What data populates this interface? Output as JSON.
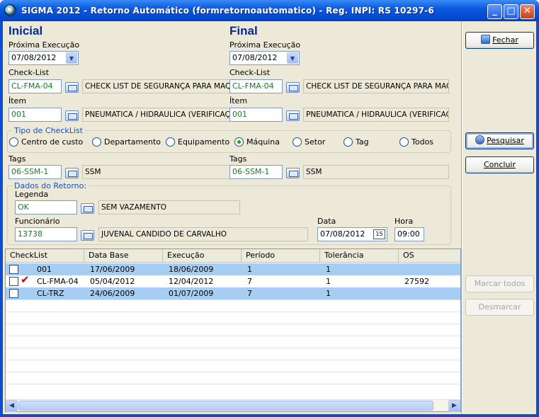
{
  "window": {
    "title": "SIGMA 2012 - Retorno Automático  (formretornoautomatico)  - Reg. INPI: RS 10297-6"
  },
  "inicial": {
    "heading": "Inicial",
    "proxima_label": "Próxima Execução",
    "proxima_value": "07/08/2012",
    "checklist_label": "Check-List",
    "checklist_code": "CL-FMA-04",
    "checklist_desc": "CHECK LIST DE SEGURANÇA PARA MAQU",
    "item_label": "Ítem",
    "item_code": "001",
    "item_desc": "PNEUMATICA / HIDRAULICA (VERIFICAÇ",
    "tags_label": "Tags",
    "tags_code": "06-SSM-1",
    "tags_desc": "SSM"
  },
  "final": {
    "heading": "Final",
    "proxima_label": "Próxima Execução",
    "proxima_value": "07/08/2012",
    "checklist_label": "Check-List",
    "checklist_code": "CL-FMA-04",
    "checklist_desc": "CHECK LIST DE SEGURANÇA PARA MAQU",
    "item_label": "Ítem",
    "item_code": "001",
    "item_desc": "PNEUMATICA / HIDRAULICA (VERIFICAÇ",
    "tags_label": "Tags",
    "tags_code": "06-SSM-1",
    "tags_desc": "SSM"
  },
  "tipo": {
    "title": "Tipo de CheckList",
    "options": [
      "Centro de custo",
      "Departamento",
      "Equipamento",
      "Máquina",
      "Setor",
      "Tag",
      "Todos"
    ],
    "selected": "Máquina"
  },
  "retorno": {
    "title": "Dados do Retorno:",
    "legenda_label": "Legenda",
    "legenda_code": "OK",
    "legenda_desc": "SEM VAZAMENTO",
    "funcionario_label": "Funcionário",
    "funcionario_code": "13738",
    "funcionario_desc": "JUVENAL CANDIDO DE CARVALHO",
    "data_label": "Data",
    "data_value": "07/08/2012",
    "data_btn": "15",
    "hora_label": "Hora",
    "hora_value": "09:00"
  },
  "buttons": {
    "fechar": "Fechar",
    "pesquisar": "Pesquisar",
    "concluir": "Concluir",
    "marcar_todos": "Marcar todos",
    "desmarcar": "Desmarcar"
  },
  "grid": {
    "columns": [
      "CheckList",
      "Data Base",
      "Execução",
      "Período",
      "Tolerância",
      "OS"
    ],
    "rows": [
      {
        "checklist": "001",
        "data_base": "17/06/2009",
        "execucao": "18/06/2009",
        "periodo": "1",
        "tolerancia": "1",
        "os": "",
        "checked": false,
        "tick": "",
        "selected": true
      },
      {
        "checklist": "CL-FMA-04",
        "data_base": "05/04/2012",
        "execucao": "12/04/2012",
        "periodo": "7",
        "tolerancia": "1",
        "os": "27592",
        "checked": false,
        "tick": "✔",
        "selected": false
      },
      {
        "checklist": "CL-TRZ",
        "data_base": "24/06/2009",
        "execucao": "01/07/2009",
        "periodo": "7",
        "tolerancia": "1",
        "os": "",
        "checked": false,
        "tick": "",
        "selected": true
      }
    ]
  },
  "colors": {
    "title_bar": "#0a5ae0",
    "selection": "#a8cdf2",
    "group_title": "#1a4fc4",
    "code_text": "#1a7a2a"
  }
}
